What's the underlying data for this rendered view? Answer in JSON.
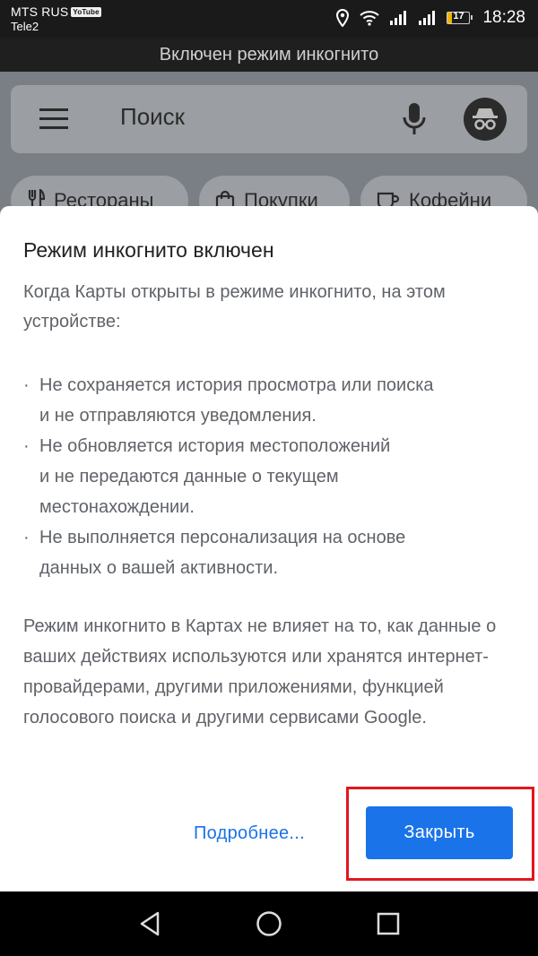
{
  "status_bar": {
    "carrier_primary": "MTS RUS",
    "carrier_badge": "YoTube",
    "carrier_secondary": "Tele2",
    "battery_level": "17",
    "battery_fraction": 0.17,
    "time": "18:28",
    "icons": [
      "location-icon",
      "wifi-icon",
      "signal-icon",
      "signal-icon",
      "battery-icon"
    ]
  },
  "banner": {
    "text": "Включен режим инкогнито"
  },
  "map": {
    "search_placeholder": "Поиск",
    "icons": [
      "menu-icon",
      "mic-icon",
      "incognito-avatar-icon"
    ],
    "chips": [
      {
        "label": "Рестораны",
        "icon": "restaurant-icon"
      },
      {
        "label": "Покупки",
        "icon": "shopping-bag-icon"
      },
      {
        "label": "Кофейни",
        "icon": "coffee-cup-icon"
      }
    ]
  },
  "dialog": {
    "title": "Режим инкогнито включен",
    "intro": "Когда Карты открыты в режиме инкогнито, на этом устройстве:",
    "bullets": [
      "Не сохраняется история просмотра или поиска\nи не отправляются уведомления.",
      "Не обновляется история местоположений\nи не передаются данные о текущем\nместонахождении.",
      "Не выполняется персонализация на основе\nданных о вашей активности."
    ],
    "bullet_char": "·",
    "footer": "Режим инкогнито в Картах не влияет на то, как данные о ваших действиях используются или хранятся интернет-провайдерами, другими приложениями, функцией голосового поиска и другими сервисами Google.",
    "more_label": "Подробнее...",
    "close_label": "Закрыть"
  },
  "colors": {
    "accent": "#1a73e8",
    "highlight": "#e0181e",
    "text_secondary": "#5f6368"
  },
  "nav_bar": {
    "icons": [
      "back-triangle-icon",
      "home-circle-icon",
      "recents-square-icon"
    ]
  }
}
